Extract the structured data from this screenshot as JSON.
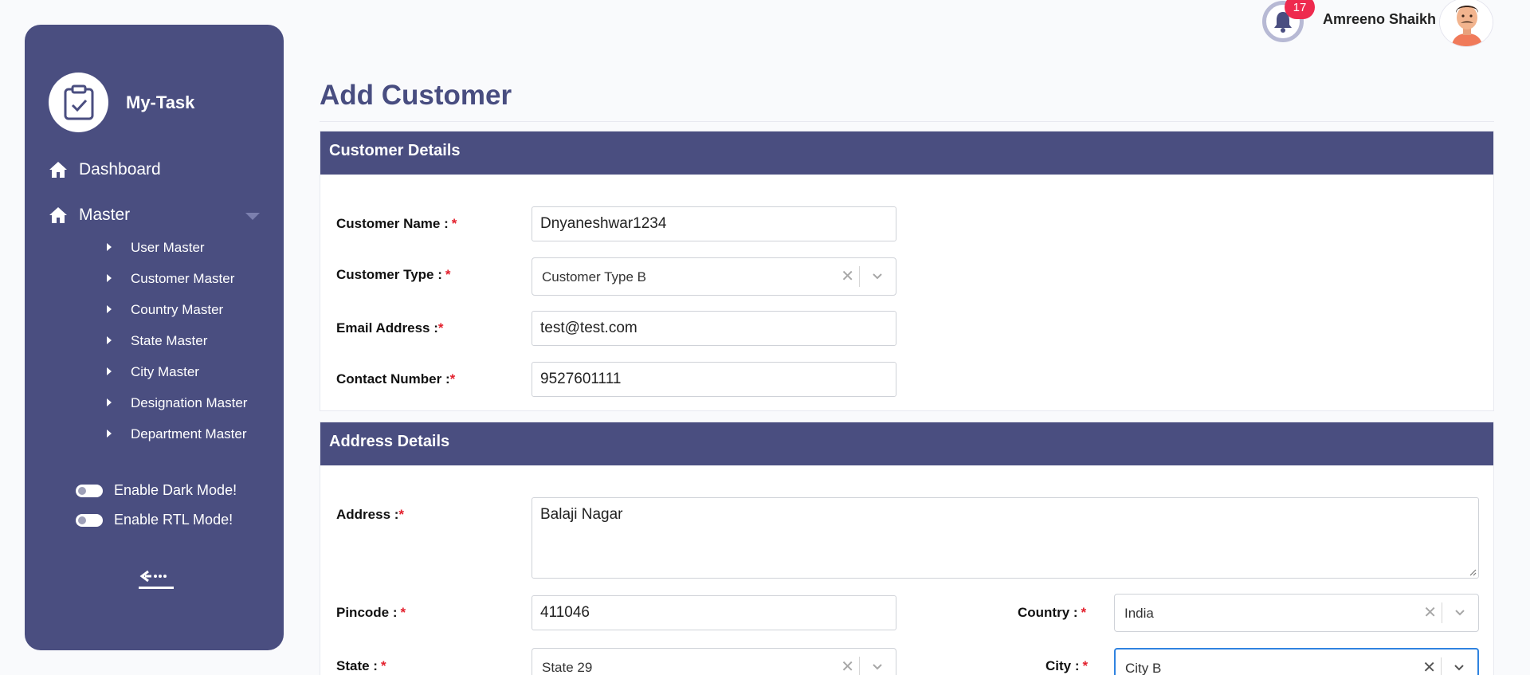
{
  "sidebar": {
    "brand": "My-Task",
    "nav": [
      {
        "label": "Dashboard"
      },
      {
        "label": "Master"
      }
    ],
    "submenu": [
      {
        "label": "User Master"
      },
      {
        "label": "Customer Master"
      },
      {
        "label": "Country Master"
      },
      {
        "label": "State Master"
      },
      {
        "label": "City Master"
      },
      {
        "label": "Designation Master"
      },
      {
        "label": "Department Master"
      }
    ],
    "toggles": {
      "dark_mode": "Enable Dark Mode!",
      "rtl_mode": "Enable RTL Mode!"
    }
  },
  "header": {
    "notification_count": "17",
    "user_name": "Amreeno Shaikh"
  },
  "page": {
    "title": "Add Customer"
  },
  "customer_details": {
    "heading": "Customer Details",
    "name_label": "Customer Name :",
    "name_value": "Dnyaneshwar1234",
    "type_label": "Customer Type :",
    "type_value": "Customer Type B",
    "email_label": "Email Address :",
    "email_value": "test@test.com",
    "contact_label": "Contact Number :",
    "contact_value": "9527601111"
  },
  "address_details": {
    "heading": "Address Details",
    "address_label": "Address :",
    "address_value": "Balaji Nagar",
    "pincode_label": "Pincode :",
    "pincode_value": "411046",
    "country_label": "Country :",
    "country_value": "India",
    "state_label": "State :",
    "state_value": "State 29",
    "city_label": "City :",
    "city_value": "City B"
  },
  "required_marker": "*",
  "clear_glyph": "✕",
  "colors": {
    "primary": "#4a4e80",
    "required": "#e3202d",
    "badge": "#ee2a4e",
    "focus": "#2f83e0"
  }
}
